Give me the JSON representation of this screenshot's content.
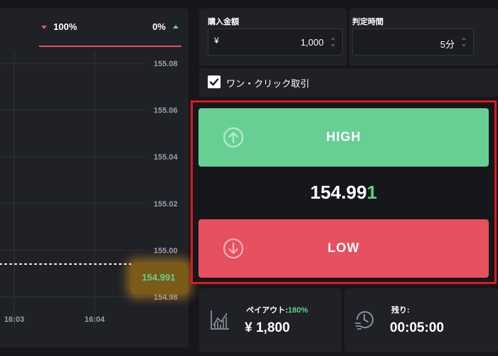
{
  "sentiment": {
    "low_pct": "100%",
    "high_pct": "0%"
  },
  "chart_data": {
    "type": "line",
    "y_ticks": [
      "155.08",
      "155.06",
      "155.04",
      "155.02",
      "155.00",
      "154.98"
    ],
    "y_tick_values": [
      155.08,
      155.06,
      155.04,
      155.02,
      155.0,
      154.98
    ],
    "x_ticks": [
      "16:03",
      "16:04"
    ],
    "current_price_value": 154.991,
    "current_price_label": "154.991",
    "grid": true
  },
  "amount": {
    "label": "購入金額",
    "currency": "¥",
    "value": "1,000"
  },
  "duration": {
    "label": "判定時間",
    "value": "5分"
  },
  "oneclick": {
    "label": "ワン・クリック取引",
    "checked": true
  },
  "trade": {
    "high_label": "HIGH",
    "low_label": "LOW",
    "price_main": "154.99",
    "price_last": "1"
  },
  "payout": {
    "title": "ペイアウト:",
    "percent": "180%",
    "value": "¥ 1,800"
  },
  "remaining": {
    "title": "残り:",
    "value": "00:05:00"
  },
  "colors": {
    "high": "#67cf94",
    "low": "#e6505f",
    "accent_green": "#5fd38f",
    "highlight_frame": "#e3161e"
  }
}
